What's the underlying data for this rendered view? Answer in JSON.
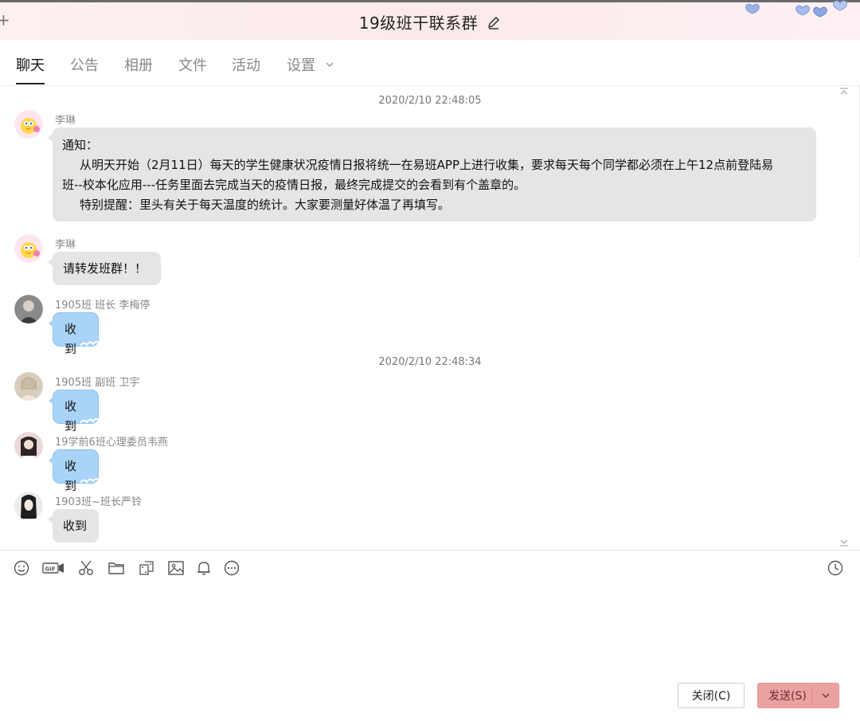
{
  "window": {
    "title": "19级班干联系群"
  },
  "tabs": [
    {
      "label": "聊天"
    },
    {
      "label": "公告"
    },
    {
      "label": "相册"
    },
    {
      "label": "文件"
    },
    {
      "label": "活动"
    },
    {
      "label": "设置"
    }
  ],
  "chat": {
    "timestamps": [
      "2020/2/10 22:48:05",
      "2020/2/10 22:48:34"
    ],
    "messages": [
      {
        "sender": "李琳",
        "lines": [
          "通知：",
          "从明天开始（2月11日）每天的学生健康状况疫情日报将统一在易班APP上进行收集，要求每天每个同学都必须在上午12点前登陆易",
          "班--校本化应用---任务里面去完成当天的疫情日报，最终完成提交的会看到有个盖章的。",
          "特别提醒：里头有关于每天温度的统计。大家要测量好体温了再填写。"
        ]
      },
      {
        "sender": "李琳",
        "text": "请转发班群！！"
      },
      {
        "sender": "1905班 班长 李梅停",
        "text": "收到"
      },
      {
        "sender": "1905班 副班 卫宇",
        "text": "收到"
      },
      {
        "sender": "19学前6班心理委员韦燕",
        "text": "收到"
      },
      {
        "sender": "1903班~班长严铃",
        "text": "收到"
      }
    ]
  },
  "compose": {
    "tools": [
      "smile-icon",
      "gif-icon",
      "scissors-icon",
      "folder-icon",
      "dice-icon",
      "image-icon",
      "bell-icon",
      "more-icon",
      "clock-icon"
    ],
    "close_label": "关闭(C)",
    "send_label": "发送(S)"
  },
  "colors": {
    "blue_bubble": "#a9d4f7",
    "gray_bubble": "#e5e5e5",
    "send_button": "#eca1a1"
  }
}
